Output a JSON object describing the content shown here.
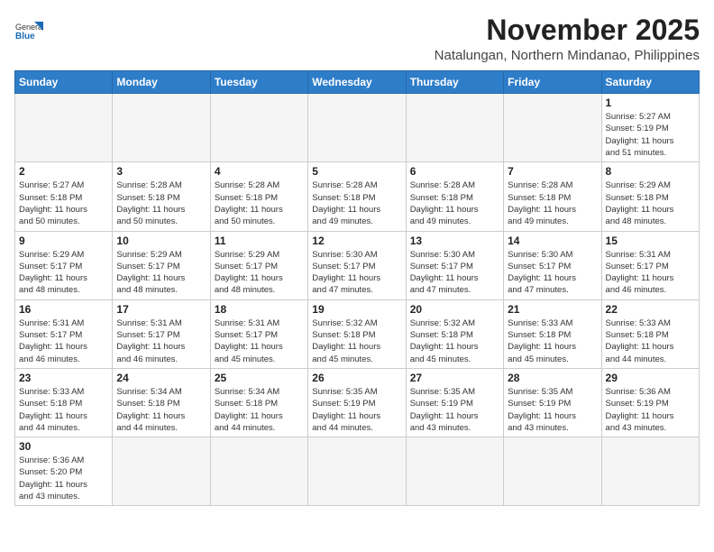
{
  "header": {
    "logo": {
      "general": "General",
      "blue": "Blue"
    },
    "title": "November 2025",
    "location": "Natalungan, Northern Mindanao, Philippines"
  },
  "weekdays": [
    "Sunday",
    "Monday",
    "Tuesday",
    "Wednesday",
    "Thursday",
    "Friday",
    "Saturday"
  ],
  "weeks": [
    [
      {
        "day": null,
        "info": null
      },
      {
        "day": null,
        "info": null
      },
      {
        "day": null,
        "info": null
      },
      {
        "day": null,
        "info": null
      },
      {
        "day": null,
        "info": null
      },
      {
        "day": null,
        "info": null
      },
      {
        "day": "1",
        "info": "Sunrise: 5:27 AM\nSunset: 5:19 PM\nDaylight: 11 hours\nand 51 minutes."
      }
    ],
    [
      {
        "day": "2",
        "info": "Sunrise: 5:27 AM\nSunset: 5:18 PM\nDaylight: 11 hours\nand 50 minutes."
      },
      {
        "day": "3",
        "info": "Sunrise: 5:28 AM\nSunset: 5:18 PM\nDaylight: 11 hours\nand 50 minutes."
      },
      {
        "day": "4",
        "info": "Sunrise: 5:28 AM\nSunset: 5:18 PM\nDaylight: 11 hours\nand 50 minutes."
      },
      {
        "day": "5",
        "info": "Sunrise: 5:28 AM\nSunset: 5:18 PM\nDaylight: 11 hours\nand 49 minutes."
      },
      {
        "day": "6",
        "info": "Sunrise: 5:28 AM\nSunset: 5:18 PM\nDaylight: 11 hours\nand 49 minutes."
      },
      {
        "day": "7",
        "info": "Sunrise: 5:28 AM\nSunset: 5:18 PM\nDaylight: 11 hours\nand 49 minutes."
      },
      {
        "day": "8",
        "info": "Sunrise: 5:29 AM\nSunset: 5:18 PM\nDaylight: 11 hours\nand 48 minutes."
      }
    ],
    [
      {
        "day": "9",
        "info": "Sunrise: 5:29 AM\nSunset: 5:17 PM\nDaylight: 11 hours\nand 48 minutes."
      },
      {
        "day": "10",
        "info": "Sunrise: 5:29 AM\nSunset: 5:17 PM\nDaylight: 11 hours\nand 48 minutes."
      },
      {
        "day": "11",
        "info": "Sunrise: 5:29 AM\nSunset: 5:17 PM\nDaylight: 11 hours\nand 48 minutes."
      },
      {
        "day": "12",
        "info": "Sunrise: 5:30 AM\nSunset: 5:17 PM\nDaylight: 11 hours\nand 47 minutes."
      },
      {
        "day": "13",
        "info": "Sunrise: 5:30 AM\nSunset: 5:17 PM\nDaylight: 11 hours\nand 47 minutes."
      },
      {
        "day": "14",
        "info": "Sunrise: 5:30 AM\nSunset: 5:17 PM\nDaylight: 11 hours\nand 47 minutes."
      },
      {
        "day": "15",
        "info": "Sunrise: 5:31 AM\nSunset: 5:17 PM\nDaylight: 11 hours\nand 46 minutes."
      }
    ],
    [
      {
        "day": "16",
        "info": "Sunrise: 5:31 AM\nSunset: 5:17 PM\nDaylight: 11 hours\nand 46 minutes."
      },
      {
        "day": "17",
        "info": "Sunrise: 5:31 AM\nSunset: 5:17 PM\nDaylight: 11 hours\nand 46 minutes."
      },
      {
        "day": "18",
        "info": "Sunrise: 5:31 AM\nSunset: 5:17 PM\nDaylight: 11 hours\nand 45 minutes."
      },
      {
        "day": "19",
        "info": "Sunrise: 5:32 AM\nSunset: 5:18 PM\nDaylight: 11 hours\nand 45 minutes."
      },
      {
        "day": "20",
        "info": "Sunrise: 5:32 AM\nSunset: 5:18 PM\nDaylight: 11 hours\nand 45 minutes."
      },
      {
        "day": "21",
        "info": "Sunrise: 5:33 AM\nSunset: 5:18 PM\nDaylight: 11 hours\nand 45 minutes."
      },
      {
        "day": "22",
        "info": "Sunrise: 5:33 AM\nSunset: 5:18 PM\nDaylight: 11 hours\nand 44 minutes."
      }
    ],
    [
      {
        "day": "23",
        "info": "Sunrise: 5:33 AM\nSunset: 5:18 PM\nDaylight: 11 hours\nand 44 minutes."
      },
      {
        "day": "24",
        "info": "Sunrise: 5:34 AM\nSunset: 5:18 PM\nDaylight: 11 hours\nand 44 minutes."
      },
      {
        "day": "25",
        "info": "Sunrise: 5:34 AM\nSunset: 5:18 PM\nDaylight: 11 hours\nand 44 minutes."
      },
      {
        "day": "26",
        "info": "Sunrise: 5:35 AM\nSunset: 5:19 PM\nDaylight: 11 hours\nand 44 minutes."
      },
      {
        "day": "27",
        "info": "Sunrise: 5:35 AM\nSunset: 5:19 PM\nDaylight: 11 hours\nand 43 minutes."
      },
      {
        "day": "28",
        "info": "Sunrise: 5:35 AM\nSunset: 5:19 PM\nDaylight: 11 hours\nand 43 minutes."
      },
      {
        "day": "29",
        "info": "Sunrise: 5:36 AM\nSunset: 5:19 PM\nDaylight: 11 hours\nand 43 minutes."
      }
    ],
    [
      {
        "day": "30",
        "info": "Sunrise: 5:36 AM\nSunset: 5:20 PM\nDaylight: 11 hours\nand 43 minutes."
      },
      {
        "day": null,
        "info": null
      },
      {
        "day": null,
        "info": null
      },
      {
        "day": null,
        "info": null
      },
      {
        "day": null,
        "info": null
      },
      {
        "day": null,
        "info": null
      },
      {
        "day": null,
        "info": null
      }
    ]
  ]
}
